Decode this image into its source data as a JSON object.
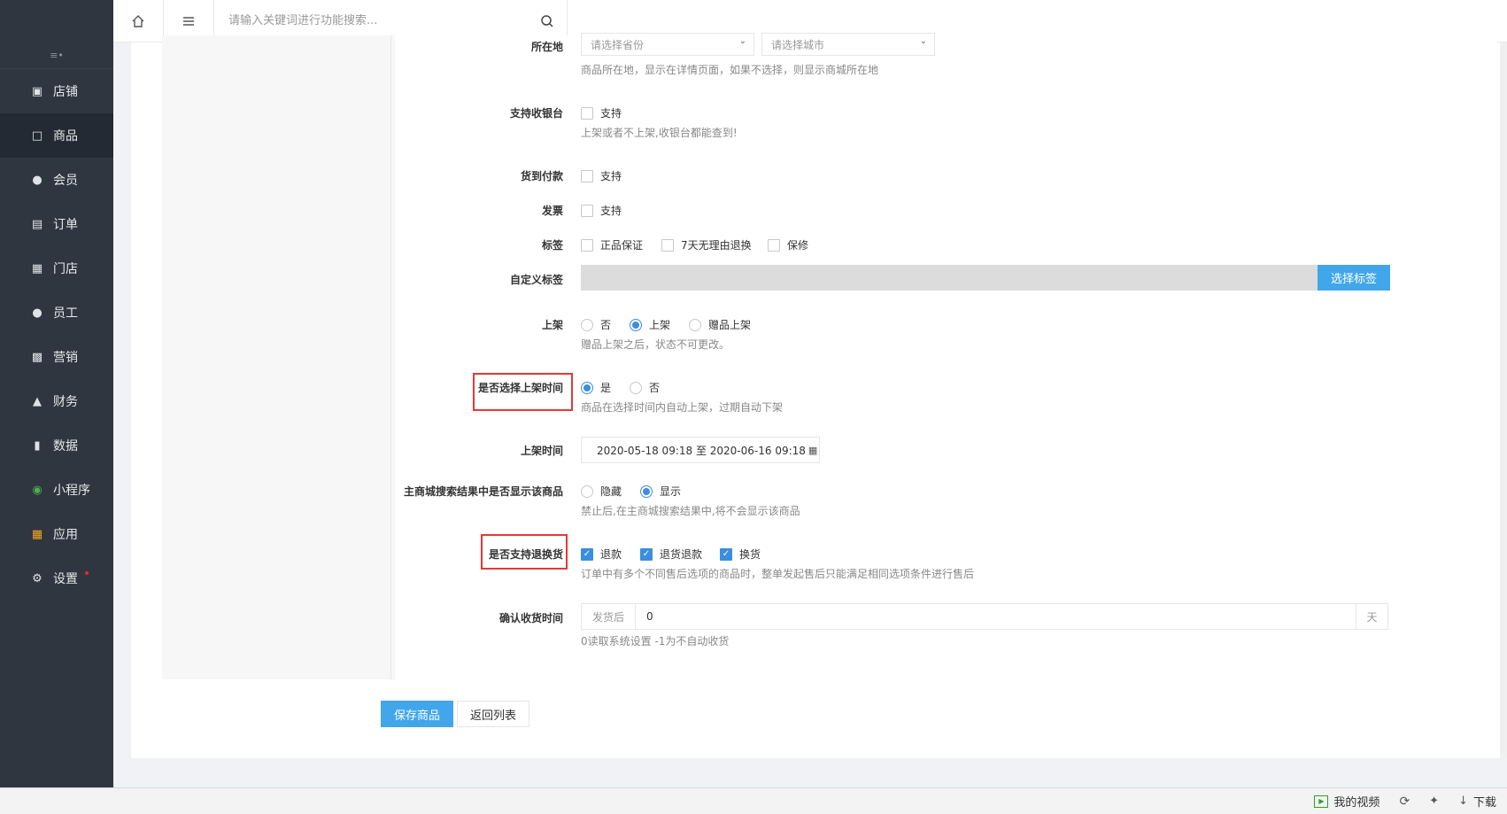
{
  "sidebar": {
    "collapse_icon": "collapse-icon",
    "items": [
      {
        "label": "店铺",
        "icon": "store-icon"
      },
      {
        "label": "商品",
        "icon": "goods-icon",
        "active": true
      },
      {
        "label": "会员",
        "icon": "member-icon"
      },
      {
        "label": "订单",
        "icon": "order-icon"
      },
      {
        "label": "门店",
        "icon": "shop-icon"
      },
      {
        "label": "员工",
        "icon": "staff-icon"
      },
      {
        "label": "营销",
        "icon": "gift-icon"
      },
      {
        "label": "财务",
        "icon": "finance-icon"
      },
      {
        "label": "数据",
        "icon": "chart-icon"
      },
      {
        "label": "小程序",
        "icon": "miniapp-icon"
      },
      {
        "label": "应用",
        "icon": "apps-icon"
      },
      {
        "label": "设置",
        "icon": "gear-icon",
        "badge_dot": true
      }
    ]
  },
  "topbar": {
    "search_placeholder": "请输入关键词进行功能搜索..."
  },
  "form": {
    "location": {
      "label": "所在地",
      "province_placeholder": "请选择省份",
      "city_placeholder": "请选择城市",
      "help": "商品所在地，显示在详情页面，如果不选择，则显示商城所在地"
    },
    "cashier": {
      "label": "支持收银台",
      "option": "支持",
      "help": "上架或者不上架,收银台都能查到!"
    },
    "cod": {
      "label": "货到付款",
      "option": "支持"
    },
    "invoice": {
      "label": "发票",
      "option": "支持"
    },
    "tags": {
      "label": "标签",
      "options": [
        "正品保证",
        "7天无理由退换",
        "保修"
      ]
    },
    "custom_tags": {
      "label": "自定义标签",
      "button": "选择标签"
    },
    "on_shelf": {
      "label": "上架",
      "options": [
        "否",
        "上架",
        "赠品上架"
      ],
      "selected": "上架",
      "help": "赠品上架之后，状态不可更改。"
    },
    "schedule": {
      "label": "是否选择上架时间",
      "options": [
        "是",
        "否"
      ],
      "selected": "是",
      "help": "商品在选择时间内自动上架，过期自动下架"
    },
    "shelf_time": {
      "label": "上架时间",
      "value": "2020-05-18 09:18 至 2020-06-16 09:18"
    },
    "search_visible": {
      "label": "主商城搜索结果中是否显示该商品",
      "options": [
        "隐藏",
        "显示"
      ],
      "selected": "显示",
      "help": "禁止后,在主商城搜索结果中,将不会显示该商品"
    },
    "returns": {
      "label": "是否支持退换货",
      "options": [
        "退款",
        "退货退款",
        "换货"
      ],
      "help": "订单中有多个不同售后选项的商品时，整单发起售后只能满足相同选项条件进行售后"
    },
    "confirm_receipt": {
      "label": "确认收货时间",
      "prefix": "发货后",
      "value": "0",
      "suffix": "天",
      "help": "0读取系统设置 -1为不自动收货"
    }
  },
  "actions": {
    "save": "保存商品",
    "back": "返回列表"
  },
  "statusbar": {
    "video": "我的视频",
    "download": "下载"
  },
  "colors": {
    "accent": "#42a7ea",
    "sidebar_bg": "#2f3640",
    "highlight_box": "#e53935"
  }
}
